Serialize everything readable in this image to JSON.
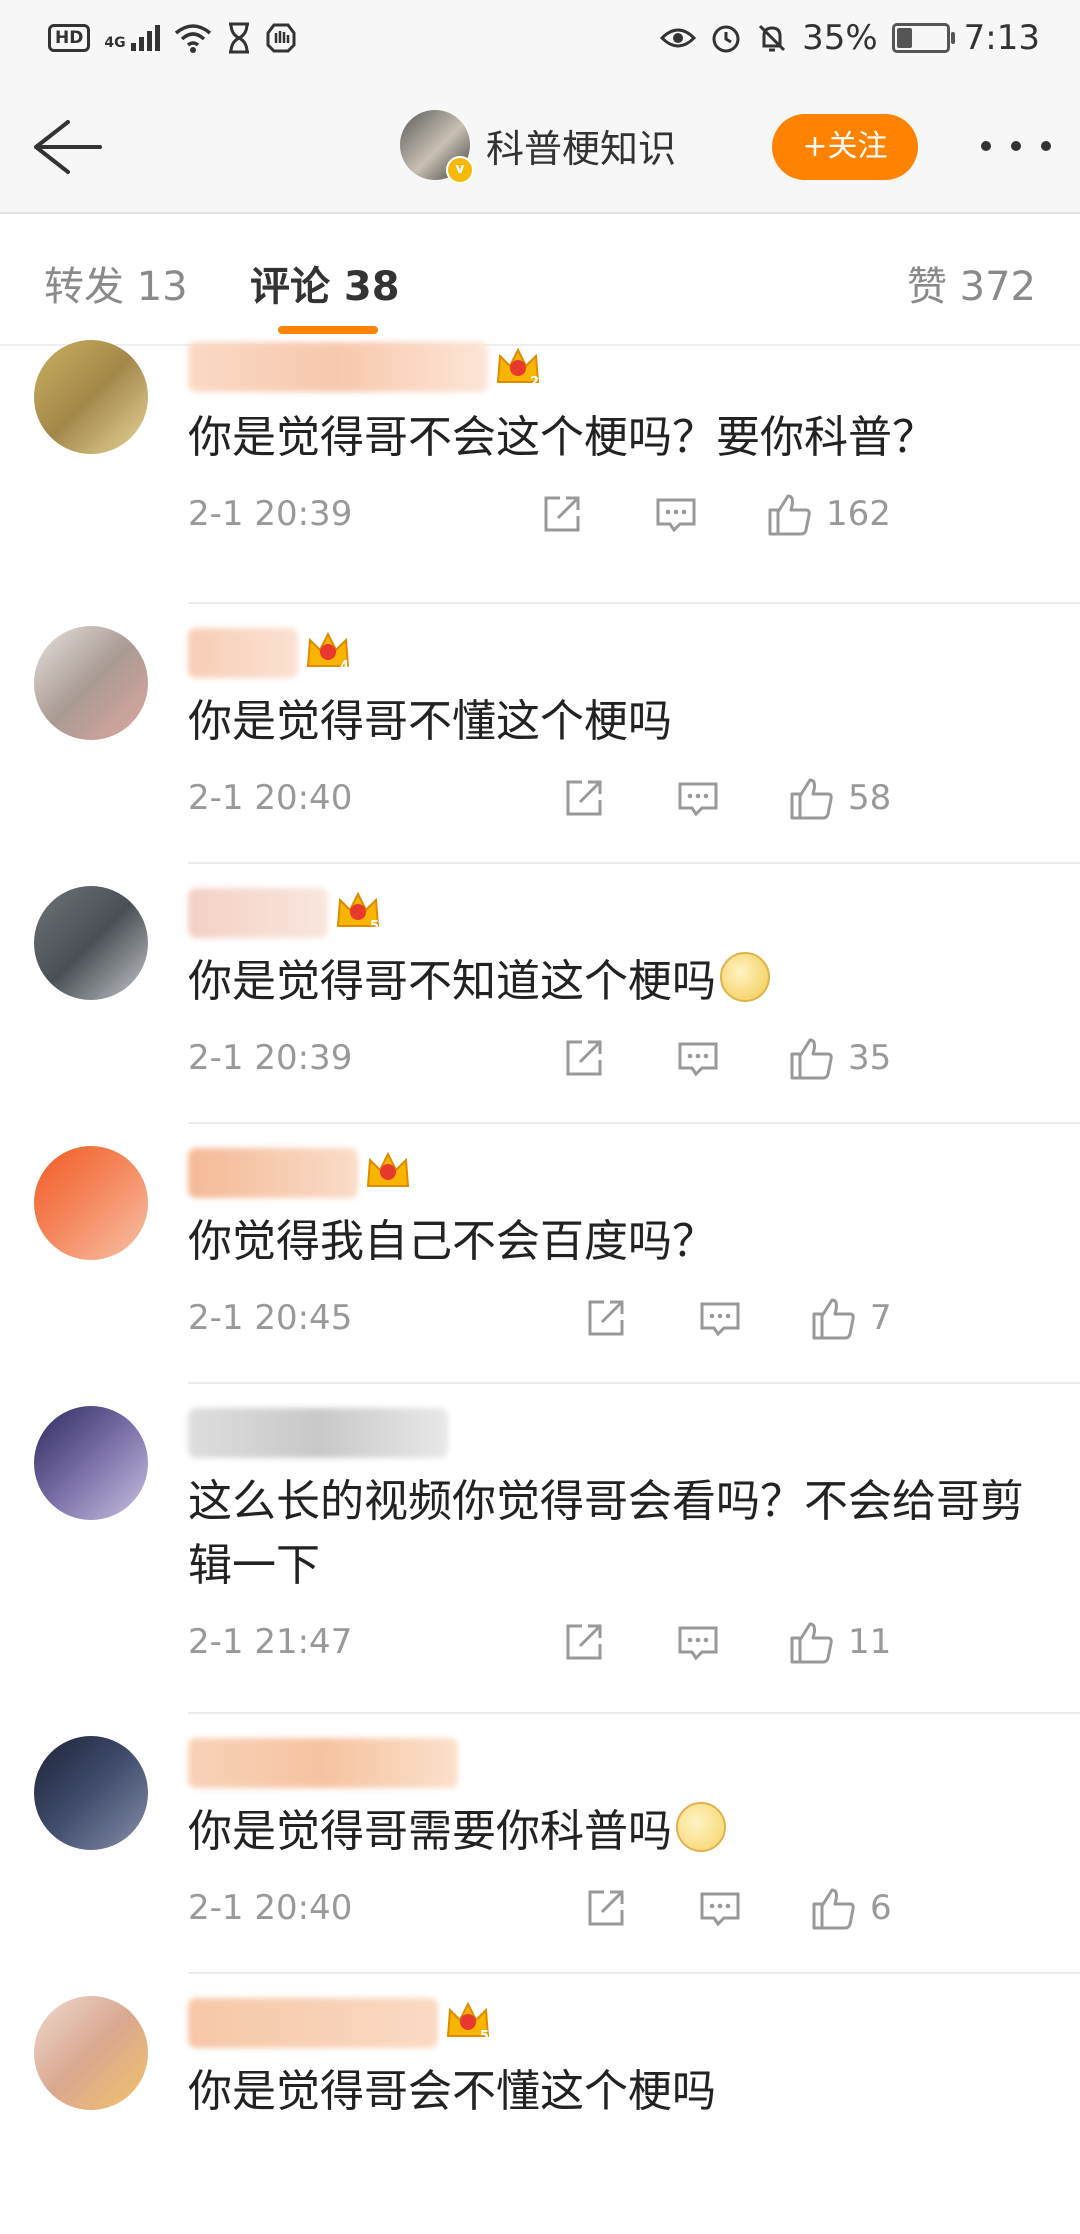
{
  "status_bar": {
    "left": {
      "hd": "HD",
      "network": "4G"
    },
    "right": {
      "battery_percent": "35%",
      "time": "7:13",
      "battery_level": 0.35
    }
  },
  "header": {
    "title": "科普梗知识",
    "follow_label": "+关注",
    "back_icon": "arrow-left-icon",
    "more_icon": "more-dots-icon"
  },
  "tabs": {
    "repost": "转发 13",
    "comments": "评论 38",
    "likes": "赞 372"
  },
  "colors": {
    "accent": "#ff8200",
    "text": "#222222",
    "muted": "#999999"
  },
  "comments": [
    {
      "text": "你是觉得哥不会这个梗吗？要你科普？",
      "time": "2-1 20:39",
      "likes": "162",
      "rank": "2"
    },
    {
      "text": "你是觉得哥不懂这个梗吗",
      "time": "2-1 20:40",
      "likes": "58",
      "rank": "4"
    },
    {
      "text": "你是觉得哥不知道这个梗吗",
      "time": "2-1 20:39",
      "likes": "35",
      "rank": "5"
    },
    {
      "text": "你觉得我自己不会百度吗？",
      "time": "2-1 20:45",
      "likes": "7",
      "rank": ""
    },
    {
      "text": "这么长的视频你觉得哥会看吗？不会给哥剪辑一下",
      "time": "2-1 21:47",
      "likes": "11",
      "rank": ""
    },
    {
      "text": "你是觉得哥需要你科普吗",
      "time": "2-1 20:40",
      "likes": "6",
      "rank": ""
    },
    {
      "text": "你是觉得哥会不懂这个梗吗",
      "time": "",
      "likes": "",
      "rank": "5"
    }
  ]
}
